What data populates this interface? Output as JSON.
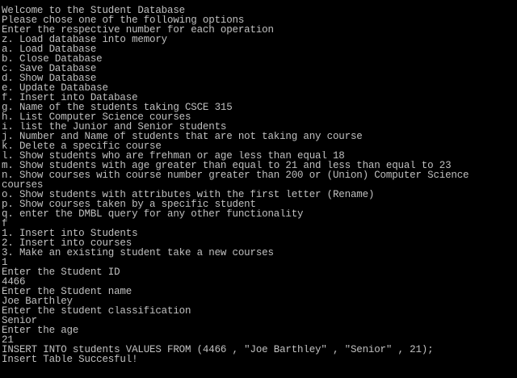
{
  "console": {
    "lines": [
      "Welcome to the Student Database",
      "Please chose one of the following options",
      "Enter the respective number for each operation",
      "z. Load database into memory",
      "a. Load Database",
      "b. Close Database",
      "c. Save Database",
      "d. Show Database",
      "e. Update Database",
      "f. Insert into Database",
      "g. Name of the students taking CSCE 315",
      "h. List Computer Science courses",
      "i. list the Junior and Senior students",
      "j. Number and Name of students that are not taking any course",
      "k. Delete a specific course",
      "l. Show students who are frehman or age less than equal 18",
      "m. Show students with age greater than equal to 21 and less than equal to 23",
      "n. Show courses with course number greater than 200 or (Union) Computer Science",
      "courses",
      "o. Show students with attributes with the first letter (Rename)",
      "p. Show courses taken by a specific student",
      "q. enter the DMBL query for any other functionality",
      "f",
      "1. Insert into Students",
      "2. Insert into courses",
      "3. Make an existing student take a new courses",
      "1",
      "Enter the Student ID",
      "4466",
      "Enter the Student name",
      "Joe Barthley",
      "Enter the student classification",
      "Senior",
      "Enter the age",
      "21",
      "INSERT INTO students VALUES FROM (4466 , \"Joe Barthley\" , \"Senior\" , 21);",
      "Insert Table Succesful!"
    ]
  }
}
